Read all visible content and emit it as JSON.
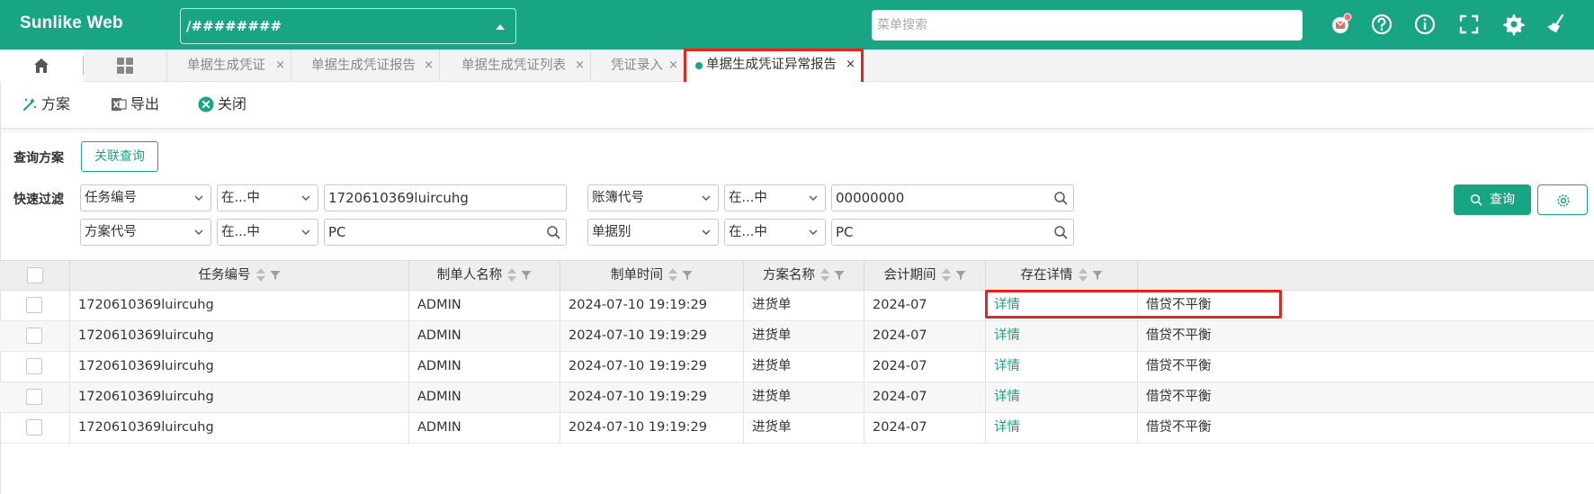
{
  "app": {
    "logo": "Sunlike Web",
    "company_select_value": "/########",
    "menu_search_placeholder": "菜单搜索"
  },
  "tabs": [
    {
      "label": "单据生成凭证",
      "active": false
    },
    {
      "label": "单据生成凭证报告",
      "active": false
    },
    {
      "label": "单据生成凭证列表",
      "active": false
    },
    {
      "label": "凭证录入",
      "active": false
    },
    {
      "label": "单据生成凭证异常报告",
      "active": true
    }
  ],
  "tab_close": "×",
  "toolbar": {
    "scheme": "方案",
    "export": "导出",
    "close": "关闭"
  },
  "filters": {
    "query_scheme_label": "查询方案",
    "linked_query_button": "关联查询",
    "quick_filter_label": "快速过滤",
    "row1": [
      {
        "field": "任务编号",
        "op": "在...中",
        "value": "1720610369luircuhg",
        "search": false
      },
      {
        "field": "账簿代号",
        "op": "在...中",
        "value": "00000000",
        "search": true
      }
    ],
    "row2": [
      {
        "field": "方案代号",
        "op": "在...中",
        "value": "PC",
        "search": true
      },
      {
        "field": "单据别",
        "op": "在...中",
        "value": "PC",
        "search": true
      }
    ],
    "query_button": "查询"
  },
  "table": {
    "columns": [
      "任务编号",
      "制单人名称",
      "制单时间",
      "方案名称",
      "会计期间",
      "存在详情",
      ""
    ],
    "rows": [
      [
        "1720610369luircuhg",
        "ADMIN",
        "2024-07-10 19:19:29",
        "进货单",
        "2024-07",
        "详情",
        "借贷不平衡"
      ],
      [
        "1720610369luircuhg",
        "ADMIN",
        "2024-07-10 19:19:29",
        "进货单",
        "2024-07",
        "详情",
        "借贷不平衡"
      ],
      [
        "1720610369luircuhg",
        "ADMIN",
        "2024-07-10 19:19:29",
        "进货单",
        "2024-07",
        "详情",
        "借贷不平衡"
      ],
      [
        "1720610369luircuhg",
        "ADMIN",
        "2024-07-10 19:19:29",
        "进货单",
        "2024-07",
        "详情",
        "借贷不平衡"
      ],
      [
        "1720610369luircuhg",
        "ADMIN",
        "2024-07-10 19:19:29",
        "进货单",
        "2024-07",
        "详情",
        "借贷不平衡"
      ]
    ]
  },
  "colors": {
    "brand": "#17a583",
    "highlight": "#e5261d",
    "notify": "#ff6b6b"
  }
}
